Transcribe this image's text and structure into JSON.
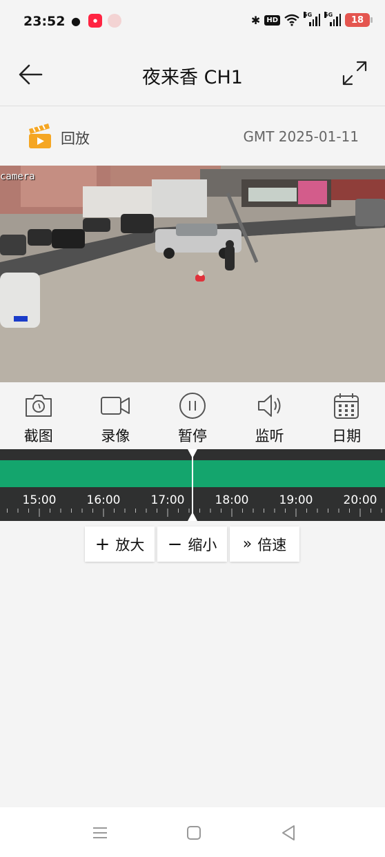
{
  "status_bar": {
    "time": "23:52",
    "hd_label": "HD",
    "signal_1": "5G",
    "signal_2": "5G",
    "battery": "18"
  },
  "header": {
    "title": "夜来香 CH1"
  },
  "playback": {
    "label": "回放",
    "date": "GMT 2025-01-11"
  },
  "video": {
    "camera_label": "camera"
  },
  "controls": [
    {
      "label": "截图",
      "icon": "camera-icon"
    },
    {
      "label": "录像",
      "icon": "video-record-icon"
    },
    {
      "label": "暂停",
      "icon": "pause-icon"
    },
    {
      "label": "监听",
      "icon": "speaker-icon"
    },
    {
      "label": "日期",
      "icon": "calendar-icon"
    }
  ],
  "timeline": {
    "hours": [
      "15:00",
      "16:00",
      "17:00",
      "18:00",
      "19:00",
      "20:00"
    ]
  },
  "zoom": {
    "zoom_in_label": "放大",
    "zoom_out_label": "缩小",
    "speed_label": "倍速"
  },
  "colors": {
    "timeline_green": "#14a56d",
    "timeline_bg": "#2f3030",
    "playback_icon": "#f5a623"
  }
}
